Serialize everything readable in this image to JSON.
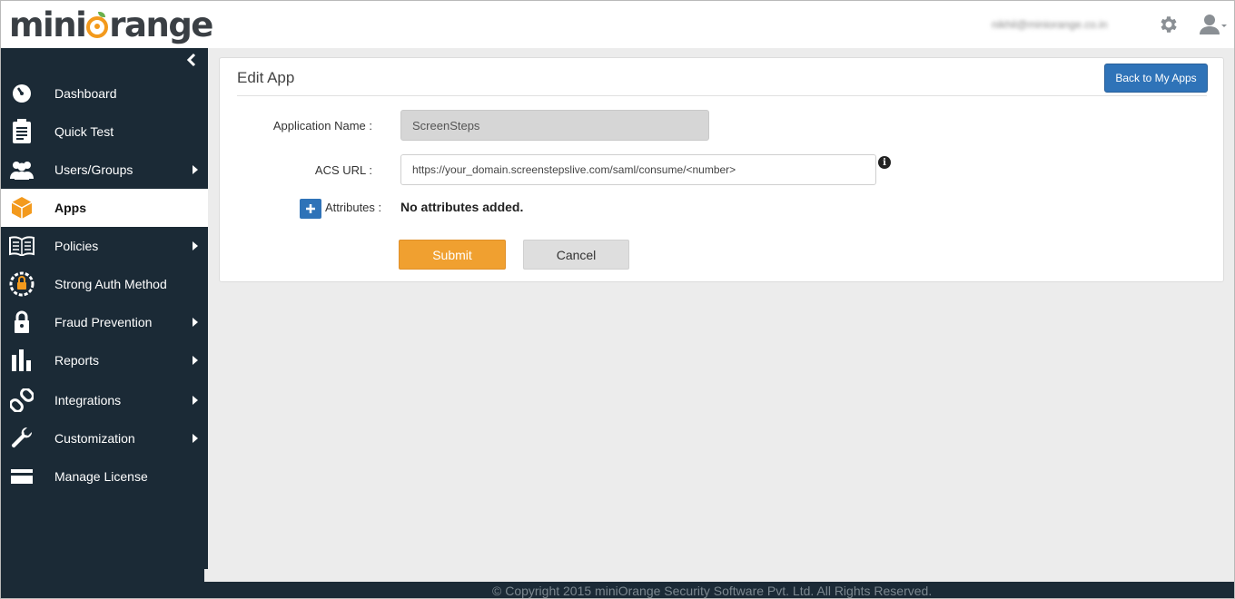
{
  "header": {
    "logo_left": "mini",
    "logo_right": "range",
    "user_email": "nikhil@miniorange.co.in",
    "settings_icon": "gear-icon",
    "user_icon": "user-icon"
  },
  "sidebar": {
    "collapse_icon": "chevron-left-icon",
    "items": [
      {
        "label": "Dashboard",
        "icon": "dashboard-icon"
      },
      {
        "label": "Quick Test",
        "icon": "clipboard-icon"
      },
      {
        "label": "Users/Groups",
        "icon": "users-icon"
      },
      {
        "label": "Apps",
        "icon": "box-icon"
      },
      {
        "label": "Policies",
        "icon": "book-icon"
      },
      {
        "label": "Strong Auth Method",
        "icon": "shield-lock-icon"
      },
      {
        "label": "Fraud Prevention",
        "icon": "lock-icon"
      },
      {
        "label": "Reports",
        "icon": "bar-chart-icon"
      },
      {
        "label": "Integrations",
        "icon": "link-icon"
      },
      {
        "label": "Customization",
        "icon": "wrench-icon"
      },
      {
        "label": "Manage License",
        "icon": "credit-card-icon"
      }
    ]
  },
  "panel": {
    "title": "Edit App",
    "back_button": "Back to My Apps",
    "app_name_label": "Application Name :",
    "app_name_value": "ScreenSteps",
    "acs_label": "ACS URL :",
    "acs_value": "https://your_domain.screenstepslive.com/saml/consume/<number>",
    "attributes_label": "Attributes :",
    "no_attributes": "No attributes added.",
    "submit": "Submit",
    "cancel": "Cancel"
  },
  "footer": {
    "copyright": "© Copyright 2015 miniOrange Security Software Pvt. Ltd. All Rights Reserved."
  },
  "colors": {
    "sidebar_bg": "#1b2a36",
    "accent_orange": "#f0a030",
    "primary_blue": "#2f73b8"
  }
}
